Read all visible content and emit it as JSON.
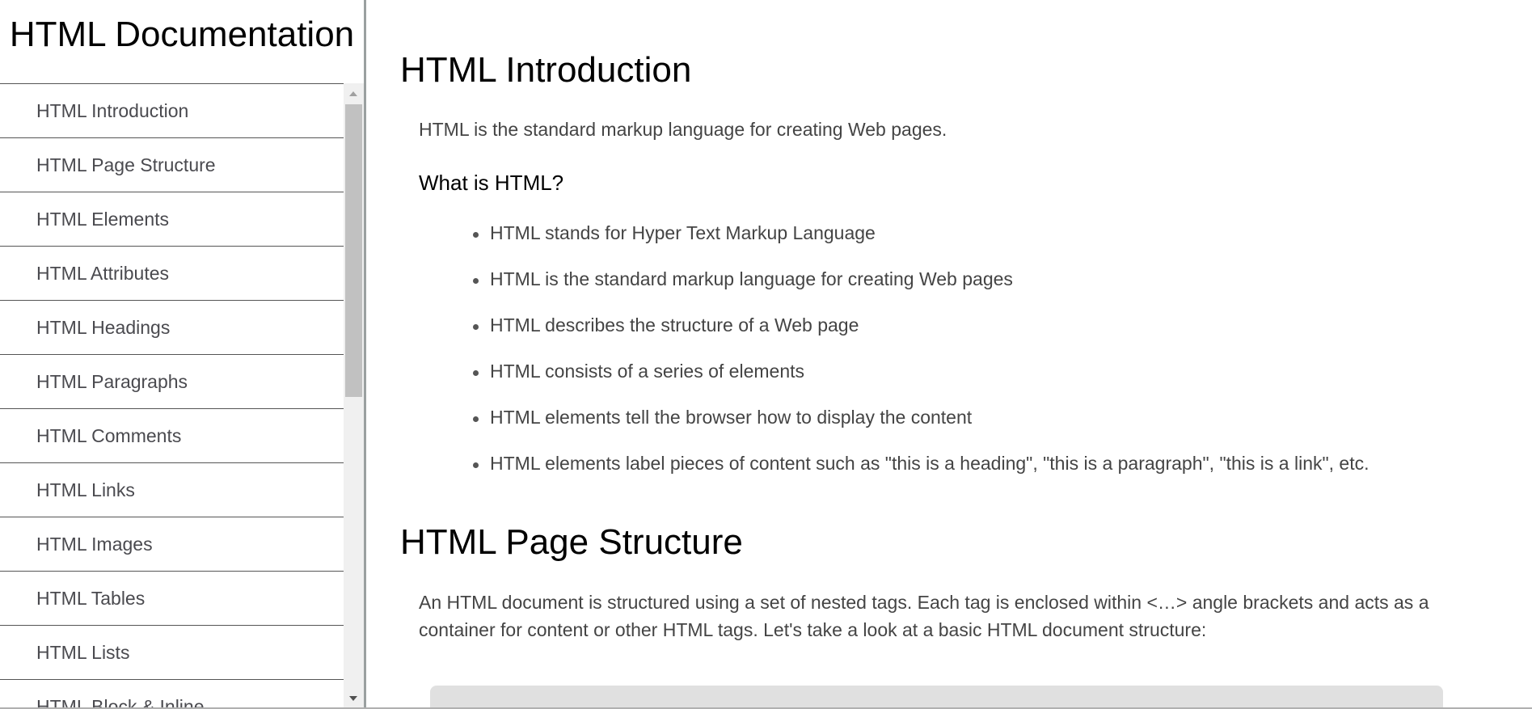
{
  "sidebar": {
    "title": "HTML Documentation",
    "items": [
      "HTML Introduction",
      "HTML Page Structure",
      "HTML Elements",
      "HTML Attributes",
      "HTML Headings",
      "HTML Paragraphs",
      "HTML Comments",
      "HTML Links",
      "HTML Images",
      "HTML Tables",
      "HTML Lists",
      "HTML Block & Inline"
    ]
  },
  "main": {
    "intro": {
      "title": "HTML Introduction",
      "text": "HTML is the standard markup language for creating Web pages.",
      "subtitle": "What is HTML?",
      "bullets": [
        "HTML stands for Hyper Text Markup Language",
        "HTML is the standard markup language for creating Web pages",
        "HTML describes the structure of a Web page",
        "HTML consists of a series of elements",
        "HTML elements tell the browser how to display the content",
        "HTML elements label pieces of content such as \"this is a heading\", \"this is a paragraph\", \"this is a link\", etc."
      ]
    },
    "structure": {
      "title": "HTML Page Structure",
      "text": "An HTML document is structured using a set of nested tags. Each tag is enclosed within <…> angle brackets and acts as a container for content or other HTML tags. Let's take a look at a basic HTML document structure:"
    }
  }
}
